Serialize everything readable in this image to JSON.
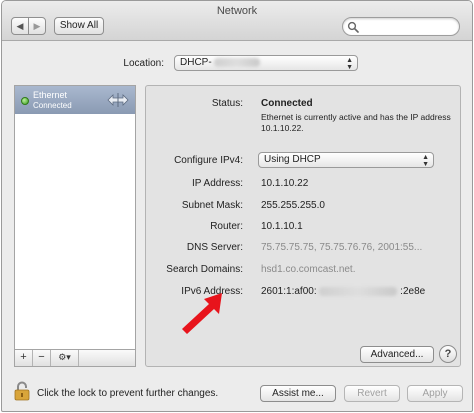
{
  "window": {
    "title": "Network",
    "back_glyph": "◀",
    "forward_glyph": "▶",
    "show_all_label": "Show All",
    "search_icon": "search-icon"
  },
  "location": {
    "label": "Location:",
    "value_visible": "DHCP-"
  },
  "sidebar": {
    "services": [
      {
        "name": "Ethernet",
        "status": "Connected",
        "status_color": "#3c9d1e",
        "icon": "ethernet-arrows-icon"
      }
    ],
    "add_glyph": "+",
    "remove_glyph": "−",
    "action_glyph": "⚙▾"
  },
  "details": {
    "status_label": "Status:",
    "status_value": "Connected",
    "status_description": "Ethernet is currently active and has the IP address 10.1.10.22.",
    "configure_label": "Configure IPv4:",
    "configure_value": "Using DHCP",
    "ip_label": "IP Address:",
    "ip_value": "10.1.10.22",
    "subnet_label": "Subnet Mask:",
    "subnet_value": "255.255.255.0",
    "router_label": "Router:",
    "router_value": "10.1.10.1",
    "dns_label": "DNS Server:",
    "dns_value": "75.75.75.75, 75.75.76.76, 2001:55...",
    "search_domains_label": "Search Domains:",
    "search_domains_value": "hsd1.co.comcast.net.",
    "ipv6_label": "IPv6 Address:",
    "ipv6_prefix": "2601:1:af00:",
    "ipv6_suffix": ":2e8e",
    "advanced_label": "Advanced...",
    "help_glyph": "?"
  },
  "footer": {
    "lock_text": "Click the lock to prevent further changes.",
    "assist_label": "Assist me...",
    "revert_label": "Revert",
    "apply_label": "Apply"
  },
  "colors": {
    "selection": "#8a9ab3",
    "annotation_arrow": "#e8141c"
  }
}
